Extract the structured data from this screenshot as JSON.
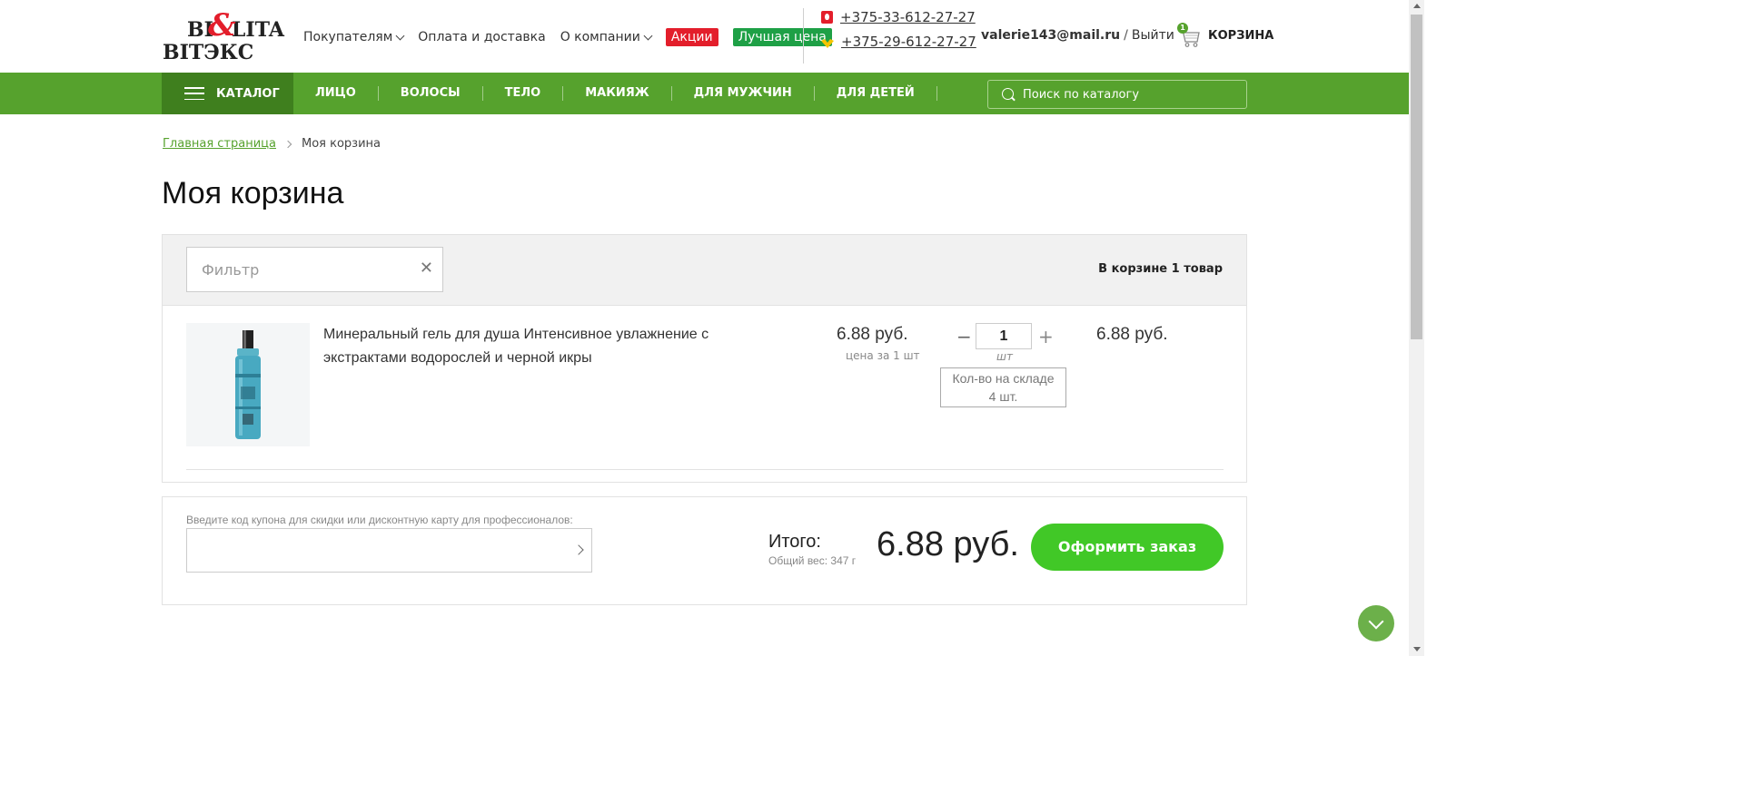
{
  "header": {
    "logo": {
      "line1": "BI",
      "amp": "&",
      "line1_rest": "LITA",
      "line2": "ВIТЭКС"
    },
    "nav": [
      {
        "label": "Покупателям",
        "dropdown": true
      },
      {
        "label": "Оплата и доставка",
        "dropdown": false
      },
      {
        "label": "О компании",
        "dropdown": true
      }
    ],
    "badges": {
      "sale": "Акции",
      "best_price": "Лучшая цена"
    },
    "phones": [
      "+375-33-612-27-27",
      "+375-29-612-27-27"
    ],
    "user_email": "valerie143@mail.ru",
    "separator": "/",
    "logout": "Выйти",
    "cart_label": "КОРЗИНА",
    "cart_count": "1"
  },
  "catalog_nav": {
    "catalog_label": "КАТАЛОГ",
    "categories": [
      "ЛИЦО",
      "ВОЛОСЫ",
      "ТЕЛО",
      "МАКИЯЖ",
      "ДЛЯ МУЖЧИН",
      "ДЛЯ ДЕТЕЙ"
    ],
    "search_placeholder": "Поиск по каталогу"
  },
  "breadcrumb": {
    "home": "Главная страница",
    "current": "Моя корзина"
  },
  "page_title": "Моя корзина",
  "cart": {
    "filter_placeholder": "Фильтр",
    "filter_clear": "✕",
    "count_text": "В корзине 1 товар",
    "items": [
      {
        "name": "Минеральный гель для душа Интенсивное увлажнение с экстрактами водорослей и черной икры",
        "price": "6.88 руб.",
        "price_note": "цена за 1 шт",
        "qty": "1",
        "qty_minus": "−",
        "qty_plus": "+",
        "qty_unit": "шт",
        "stock_label": "Кол-во на складе",
        "stock_value": "4 шт.",
        "total": "6.88 руб."
      }
    ]
  },
  "summary": {
    "coupon_label": "Введите код купона для скидки или дисконтную карту для профессионалов:",
    "total_label": "Итого:",
    "weight": "Общий вес: 347 г",
    "grand_total": "6.88 руб.",
    "checkout_label": "Оформить заказ"
  },
  "colors": {
    "brand_green": "#56a22d",
    "dark_green": "#3f7f1e",
    "checkout_green": "#41c827",
    "red": "#e31e2b"
  }
}
